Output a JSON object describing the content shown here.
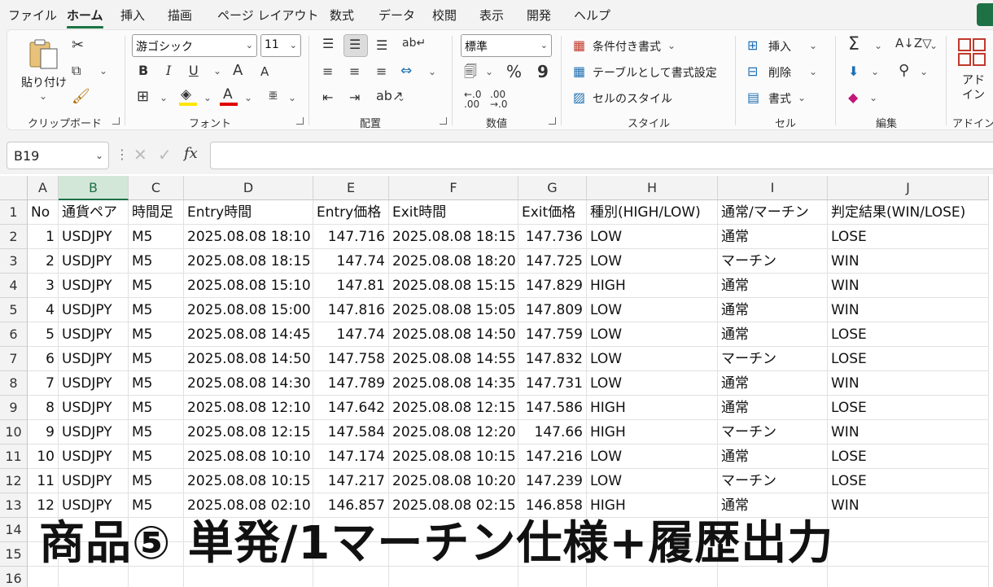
{
  "menu": {
    "tabs": [
      "ファイル",
      "ホーム",
      "挿入",
      "描画",
      "ページ レイアウト",
      "数式",
      "データ",
      "校閲",
      "表示",
      "開発",
      "ヘルプ"
    ],
    "active": "ホーム"
  },
  "ribbon": {
    "clipboard": {
      "paste_label": "貼り付け",
      "group_label": "クリップボード"
    },
    "font": {
      "font_name": "游ゴシック",
      "font_size": "11",
      "bold": "B",
      "italic": "I",
      "underline": "U",
      "grow": "A",
      "shrink": "A",
      "font_color_letter": "A",
      "phonetic": "亜",
      "group_label": "フォント"
    },
    "alignment": {
      "group_label": "配置"
    },
    "number": {
      "format": "標準",
      "percent": "%",
      "comma": "9",
      "group_label": "数値"
    },
    "styles": {
      "conditional": "条件付き書式",
      "as_table": "テーブルとして書式設定",
      "cell_styles": "セルのスタイル",
      "group_label": "スタイル"
    },
    "cells": {
      "insert": "挿入",
      "delete": "削除",
      "format": "書式",
      "group_label": "セル"
    },
    "editing": {
      "sum": "Σ",
      "group_label": "編集"
    },
    "addins": {
      "label": "アド\nイン",
      "group_label": "アドイン"
    }
  },
  "formula_bar": {
    "name_box": "B19",
    "fx": "fx",
    "formula": ""
  },
  "sheet": {
    "selected_column": "B",
    "columns": [
      "A",
      "B",
      "C",
      "D",
      "E",
      "F",
      "G",
      "H",
      "I",
      "J"
    ],
    "row_numbers": [
      "1",
      "2",
      "3",
      "4",
      "5",
      "6",
      "7",
      "8",
      "9",
      "10",
      "11",
      "12",
      "13",
      "14",
      "15",
      "16"
    ],
    "header": [
      "No",
      "通貨ペア",
      "時間足",
      "Entry時間",
      "Entry価格",
      "Exit時間",
      "Exit価格",
      "種別(HIGH/LOW)",
      "通常/マーチン",
      "判定結果(WIN/LOSE)"
    ],
    "rows": [
      [
        "1",
        "USDJPY",
        "M5",
        "2025.08.08 18:10",
        "147.716",
        "2025.08.08 18:15",
        "147.736",
        "LOW",
        "通常",
        "LOSE"
      ],
      [
        "2",
        "USDJPY",
        "M5",
        "2025.08.08 18:15",
        "147.74",
        "2025.08.08 18:20",
        "147.725",
        "LOW",
        "マーチン",
        "WIN"
      ],
      [
        "3",
        "USDJPY",
        "M5",
        "2025.08.08 15:10",
        "147.81",
        "2025.08.08 15:15",
        "147.829",
        "HIGH",
        "通常",
        "WIN"
      ],
      [
        "4",
        "USDJPY",
        "M5",
        "2025.08.08 15:00",
        "147.816",
        "2025.08.08 15:05",
        "147.809",
        "LOW",
        "通常",
        "WIN"
      ],
      [
        "5",
        "USDJPY",
        "M5",
        "2025.08.08 14:45",
        "147.74",
        "2025.08.08 14:50",
        "147.759",
        "LOW",
        "通常",
        "LOSE"
      ],
      [
        "6",
        "USDJPY",
        "M5",
        "2025.08.08 14:50",
        "147.758",
        "2025.08.08 14:55",
        "147.832",
        "LOW",
        "マーチン",
        "LOSE"
      ],
      [
        "7",
        "USDJPY",
        "M5",
        "2025.08.08 14:30",
        "147.789",
        "2025.08.08 14:35",
        "147.731",
        "LOW",
        "通常",
        "WIN"
      ],
      [
        "8",
        "USDJPY",
        "M5",
        "2025.08.08 12:10",
        "147.642",
        "2025.08.08 12:15",
        "147.586",
        "HIGH",
        "通常",
        "LOSE"
      ],
      [
        "9",
        "USDJPY",
        "M5",
        "2025.08.08 12:15",
        "147.584",
        "2025.08.08 12:20",
        "147.66",
        "HIGH",
        "マーチン",
        "WIN"
      ],
      [
        "10",
        "USDJPY",
        "M5",
        "2025.08.08 10:10",
        "147.174",
        "2025.08.08 10:15",
        "147.216",
        "LOW",
        "通常",
        "LOSE"
      ],
      [
        "11",
        "USDJPY",
        "M5",
        "2025.08.08 10:15",
        "147.217",
        "2025.08.08 10:20",
        "147.239",
        "LOW",
        "マーチン",
        "LOSE"
      ],
      [
        "12",
        "USDJPY",
        "M5",
        "2025.08.08 02:10",
        "146.857",
        "2025.08.08 02:15",
        "146.858",
        "HIGH",
        "通常",
        "WIN"
      ]
    ]
  },
  "banner": "商品⑤ 単発/1マーチン仕様+履歴出力"
}
